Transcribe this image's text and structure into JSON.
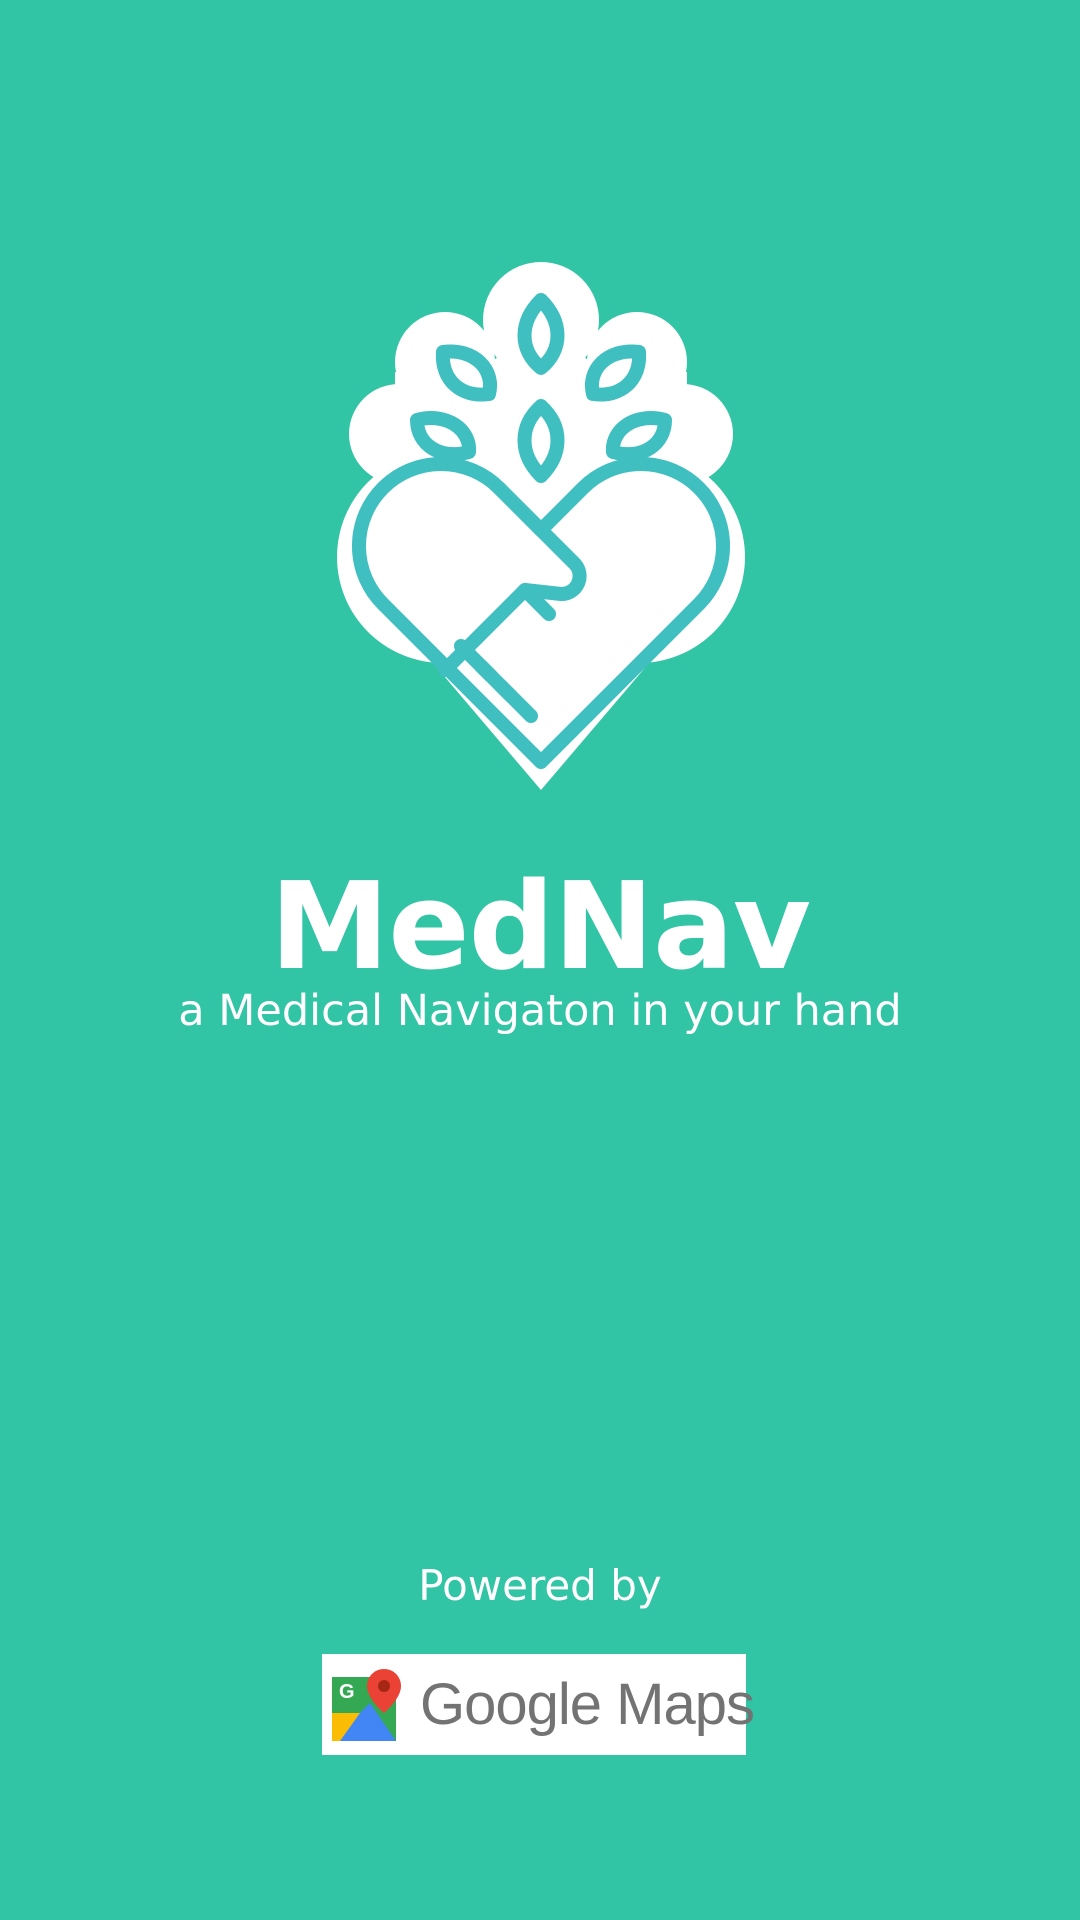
{
  "app": {
    "name": "MedNav",
    "tagline": "a Medical Navigaton in your hand"
  },
  "footer": {
    "powered_by": "Powered by",
    "provider_name": "Google Maps",
    "provider_icon": "google-maps-pin-icon"
  },
  "colors": {
    "background": "#31c4a5",
    "logo_stroke": "#3fbfc0",
    "text": "#ffffff",
    "maps_wordmark": "#737373"
  },
  "logo": {
    "icon": "heart-hand-leaves-icon"
  }
}
